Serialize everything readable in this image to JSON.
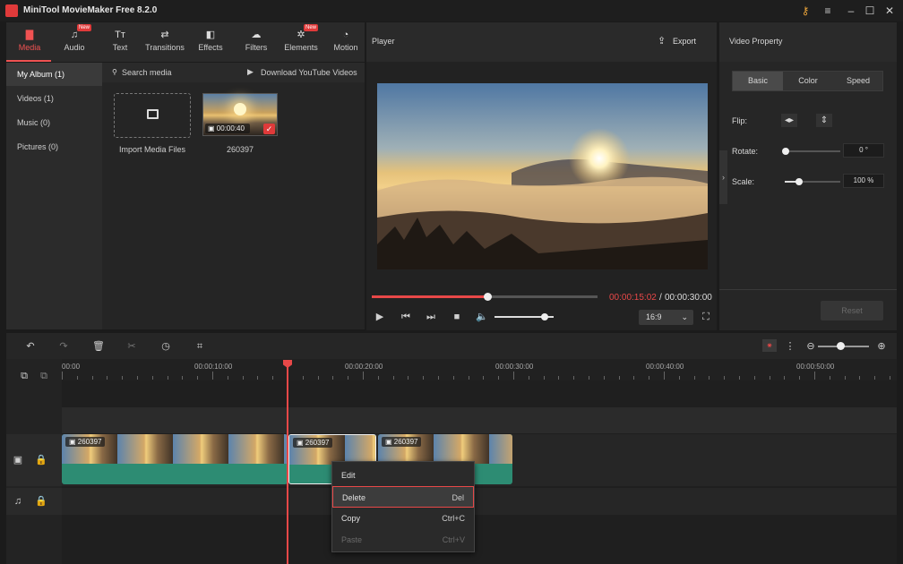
{
  "app": {
    "title": "MiniTool MovieMaker Free 8.2.0"
  },
  "toolbar": {
    "tabs": [
      {
        "label": "Media",
        "icon": "folder-icon",
        "glyph": "▇",
        "active": true,
        "new": false
      },
      {
        "label": "Audio",
        "icon": "music-note-icon",
        "glyph": "♫",
        "active": false,
        "new": true
      },
      {
        "label": "Text",
        "icon": "text-icon",
        "glyph": "Tт",
        "active": false,
        "new": false
      },
      {
        "label": "Transitions",
        "icon": "transitions-icon",
        "glyph": "⇄",
        "active": false,
        "new": false
      },
      {
        "label": "Effects",
        "icon": "effects-icon",
        "glyph": "◧",
        "active": false,
        "new": false
      },
      {
        "label": "Filters",
        "icon": "filters-icon",
        "glyph": "☁",
        "active": false,
        "new": false
      },
      {
        "label": "Elements",
        "icon": "elements-icon",
        "glyph": "✲",
        "active": false,
        "new": true
      },
      {
        "label": "Motion",
        "icon": "motion-icon",
        "glyph": "◔",
        "active": false,
        "new": false
      }
    ],
    "new_badge": "New"
  },
  "sidebar": {
    "items": [
      {
        "label": "My Album (1)",
        "selected": true
      },
      {
        "label": "Videos (1)",
        "selected": false
      },
      {
        "label": "Music (0)",
        "selected": false
      },
      {
        "label": "Pictures (0)",
        "selected": false
      }
    ]
  },
  "media": {
    "search_placeholder": "Search media",
    "download_label": "Download YouTube Videos",
    "import_label": "Import Media Files",
    "clip": {
      "name": "260397",
      "duration": "00:00:40",
      "checked": true
    }
  },
  "player": {
    "title": "Player",
    "export_label": "Export",
    "current_time": "00:00:15:02",
    "separator": "/",
    "total_time": "00:00:30:00",
    "progress": 0.51,
    "volume": 0.85,
    "aspect": "16:9"
  },
  "property": {
    "title": "Video Property",
    "tabs": [
      "Basic",
      "Color",
      "Speed"
    ],
    "selected_tab": "Basic",
    "flip_label": "Flip:",
    "rotate_label": "Rotate:",
    "rotate_value": "0 °",
    "scale_label": "Scale:",
    "scale_value": "100 %",
    "reset_label": "Reset"
  },
  "timeline": {
    "ticks": [
      "00:00",
      "00:00:10:00",
      "00:00:20:00",
      "00:00:30:00",
      "00:00:40:00",
      "00:00:50:00"
    ],
    "clips": [
      {
        "name": "260397"
      },
      {
        "name": "260397"
      },
      {
        "name": "260397"
      }
    ]
  },
  "context_menu": {
    "items": [
      {
        "label": "Edit",
        "shortcut": "",
        "state": "normal"
      },
      {
        "label": "Delete",
        "shortcut": "Del",
        "state": "highlighted"
      },
      {
        "label": "Copy",
        "shortcut": "Ctrl+C",
        "state": "normal"
      },
      {
        "label": "Paste",
        "shortcut": "Ctrl+V",
        "state": "disabled"
      }
    ]
  },
  "colors": {
    "accent": "#e84848",
    "track_green": "#2d8c73"
  }
}
